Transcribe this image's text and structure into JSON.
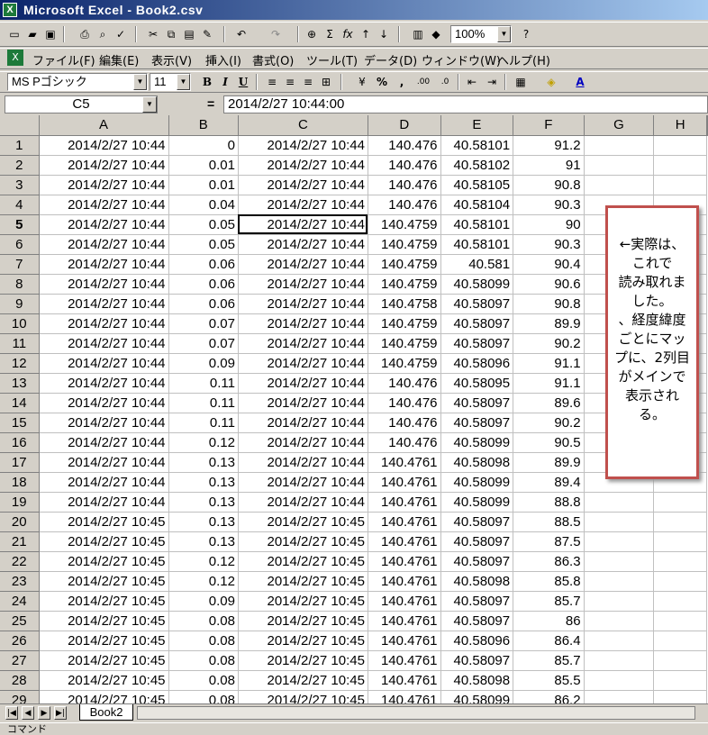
{
  "window": {
    "title": "Microsoft Excel - Book2.csv"
  },
  "toolbar": {
    "zoom": "100%",
    "font_name": "MS Pゴシック",
    "font_size": "11",
    "bold": "B",
    "italic": "I",
    "underline": "U",
    "percent": "%",
    "comma": ","
  },
  "menu": [
    "ファイル(F)",
    "編集(E)",
    "表示(V)",
    "挿入(I)",
    "書式(O)",
    "ツール(T)",
    "データ(D)",
    "ウィンドウ(W)",
    "ヘルプ(H)"
  ],
  "formula_bar": {
    "name_box": "C5",
    "eq": "=",
    "value": "2014/2/27  10:44:00"
  },
  "columns": [
    "A",
    "B",
    "C",
    "D",
    "E",
    "F",
    "G",
    "H"
  ],
  "rows": [
    [
      "1",
      "2014/2/27 10:44",
      "0",
      "2014/2/27 10:44",
      "140.476",
      "40.58101",
      "91.2"
    ],
    [
      "2",
      "2014/2/27 10:44",
      "0.01",
      "2014/2/27 10:44",
      "140.476",
      "40.58102",
      "91"
    ],
    [
      "3",
      "2014/2/27 10:44",
      "0.01",
      "2014/2/27 10:44",
      "140.476",
      "40.58105",
      "90.8"
    ],
    [
      "4",
      "2014/2/27 10:44",
      "0.04",
      "2014/2/27 10:44",
      "140.476",
      "40.58104",
      "90.3"
    ],
    [
      "5",
      "2014/2/27 10:44",
      "0.05",
      "2014/2/27 10:44",
      "140.4759",
      "40.58101",
      "90"
    ],
    [
      "6",
      "2014/2/27 10:44",
      "0.05",
      "2014/2/27 10:44",
      "140.4759",
      "40.58101",
      "90.3"
    ],
    [
      "7",
      "2014/2/27 10:44",
      "0.06",
      "2014/2/27 10:44",
      "140.4759",
      "40.581",
      "90.4"
    ],
    [
      "8",
      "2014/2/27 10:44",
      "0.06",
      "2014/2/27 10:44",
      "140.4759",
      "40.58099",
      "90.6"
    ],
    [
      "9",
      "2014/2/27 10:44",
      "0.06",
      "2014/2/27 10:44",
      "140.4758",
      "40.58097",
      "90.8"
    ],
    [
      "10",
      "2014/2/27 10:44",
      "0.07",
      "2014/2/27 10:44",
      "140.4759",
      "40.58097",
      "89.9"
    ],
    [
      "11",
      "2014/2/27 10:44",
      "0.07",
      "2014/2/27 10:44",
      "140.4759",
      "40.58097",
      "90.2"
    ],
    [
      "12",
      "2014/2/27 10:44",
      "0.09",
      "2014/2/27 10:44",
      "140.4759",
      "40.58096",
      "91.1"
    ],
    [
      "13",
      "2014/2/27 10:44",
      "0.11",
      "2014/2/27 10:44",
      "140.476",
      "40.58095",
      "91.1"
    ],
    [
      "14",
      "2014/2/27 10:44",
      "0.11",
      "2014/2/27 10:44",
      "140.476",
      "40.58097",
      "89.6"
    ],
    [
      "15",
      "2014/2/27 10:44",
      "0.11",
      "2014/2/27 10:44",
      "140.476",
      "40.58097",
      "90.2"
    ],
    [
      "16",
      "2014/2/27 10:44",
      "0.12",
      "2014/2/27 10:44",
      "140.476",
      "40.58099",
      "90.5"
    ],
    [
      "17",
      "2014/2/27 10:44",
      "0.13",
      "2014/2/27 10:44",
      "140.4761",
      "40.58098",
      "89.9"
    ],
    [
      "18",
      "2014/2/27 10:44",
      "0.13",
      "2014/2/27 10:44",
      "140.4761",
      "40.58099",
      "89.4"
    ],
    [
      "19",
      "2014/2/27 10:44",
      "0.13",
      "2014/2/27 10:44",
      "140.4761",
      "40.58099",
      "88.8"
    ],
    [
      "20",
      "2014/2/27 10:45",
      "0.13",
      "2014/2/27 10:45",
      "140.4761",
      "40.58097",
      "88.5"
    ],
    [
      "21",
      "2014/2/27 10:45",
      "0.13",
      "2014/2/27 10:45",
      "140.4761",
      "40.58097",
      "87.5"
    ],
    [
      "22",
      "2014/2/27 10:45",
      "0.12",
      "2014/2/27 10:45",
      "140.4761",
      "40.58097",
      "86.3"
    ],
    [
      "23",
      "2014/2/27 10:45",
      "0.12",
      "2014/2/27 10:45",
      "140.4761",
      "40.58098",
      "85.8"
    ],
    [
      "24",
      "2014/2/27 10:45",
      "0.09",
      "2014/2/27 10:45",
      "140.4761",
      "40.58097",
      "85.7"
    ],
    [
      "25",
      "2014/2/27 10:45",
      "0.08",
      "2014/2/27 10:45",
      "140.4761",
      "40.58097",
      "86"
    ],
    [
      "26",
      "2014/2/27 10:45",
      "0.08",
      "2014/2/27 10:45",
      "140.4761",
      "40.58096",
      "86.4"
    ],
    [
      "27",
      "2014/2/27 10:45",
      "0.08",
      "2014/2/27 10:45",
      "140.4761",
      "40.58097",
      "85.7"
    ],
    [
      "28",
      "2014/2/27 10:45",
      "0.08",
      "2014/2/27 10:45",
      "140.4761",
      "40.58098",
      "85.5"
    ],
    [
      "29",
      "2014/2/27 10:45",
      "0.08",
      "2014/2/27 10:45",
      "140.4761",
      "40.58099",
      "86.2"
    ]
  ],
  "active_row": "5",
  "callout": "←実際は、\nこれで\n読み取れま\nした。\n、経度緯度\nごとにマッ\nプに、2列目\nがメインで\n表示され\nる。",
  "sheet_tab": "Book2",
  "status": "コマンド",
  "colors": {
    "title_start": "#0a246a",
    "title_end": "#a6caf0",
    "callout_border": "#c0504d"
  }
}
